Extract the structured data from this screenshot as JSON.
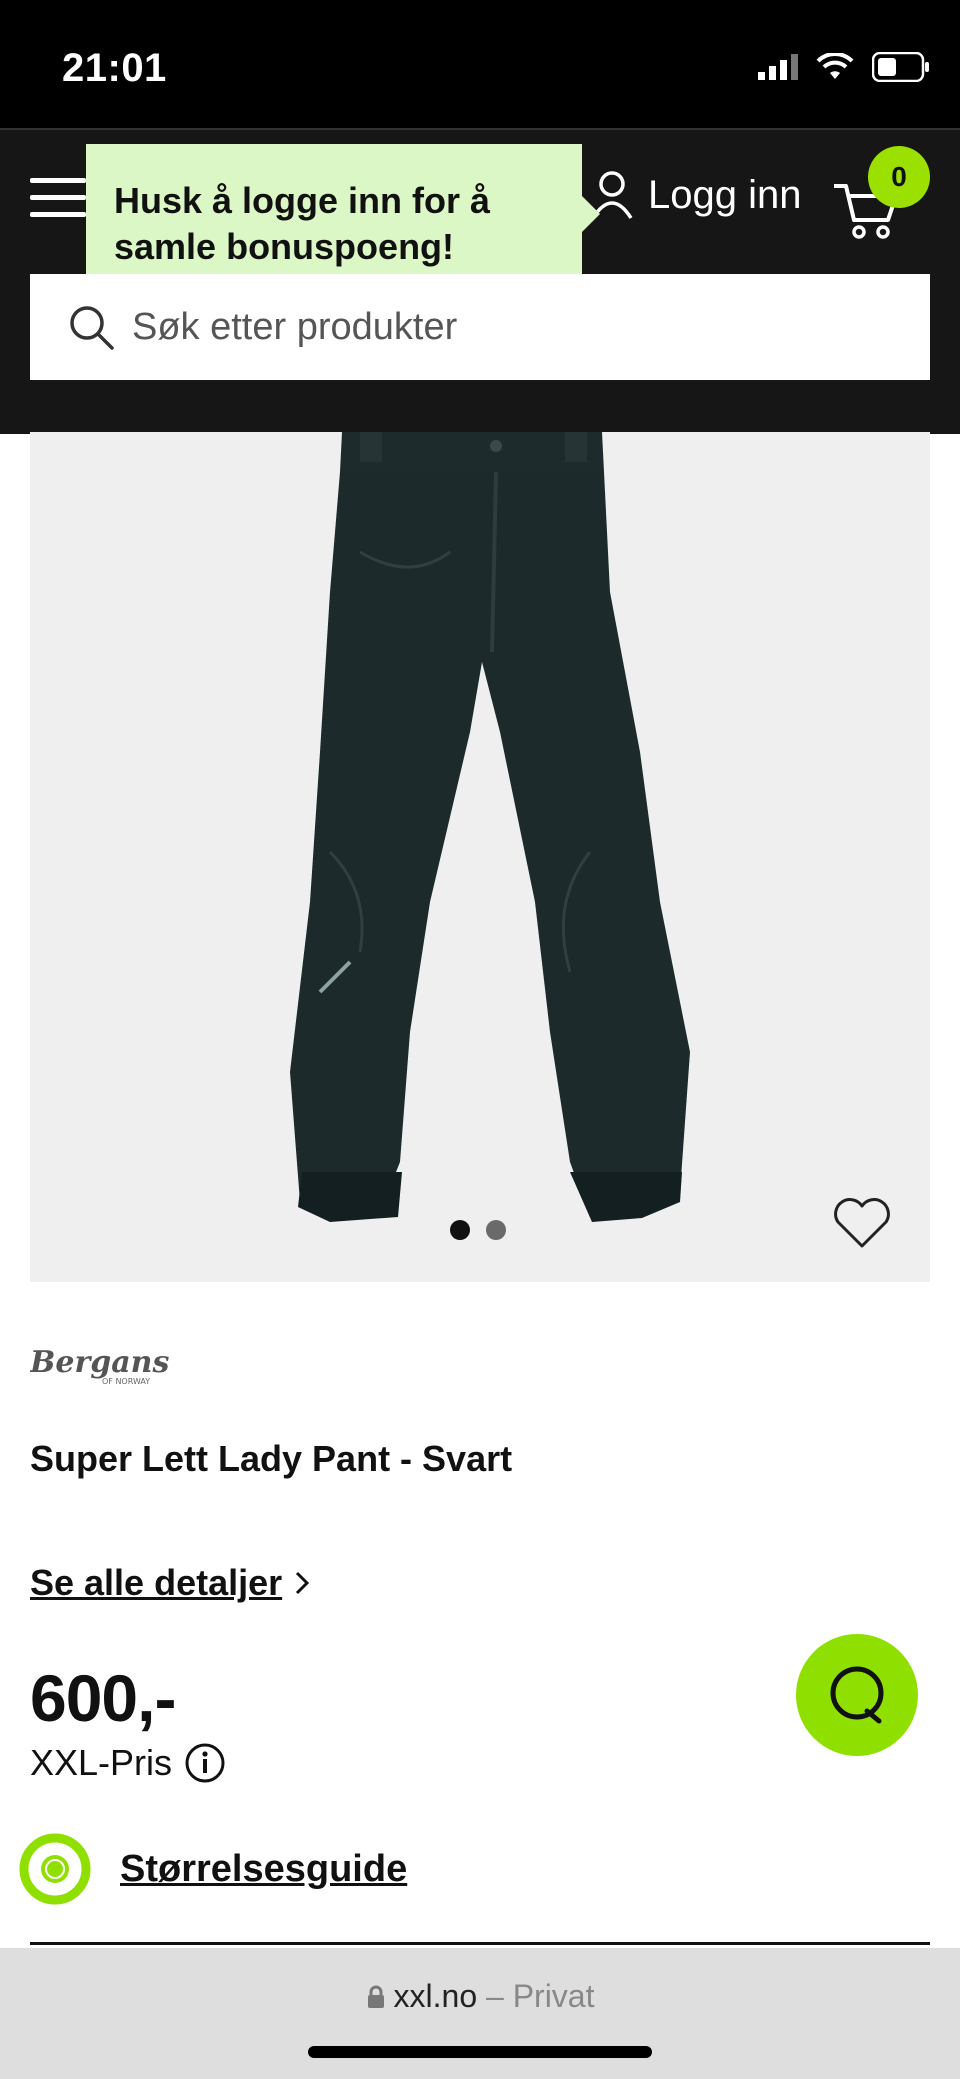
{
  "status": {
    "time": "21:01"
  },
  "header": {
    "tooltip": "Husk å logge inn for å samle bonuspoeng!",
    "login_label": "Logg inn",
    "cart_count": "0",
    "search_placeholder": "Søk etter produkter",
    "accent_color": "#9be000"
  },
  "gallery": {
    "dots": 2,
    "active_index": 0
  },
  "product": {
    "brand": "Bergans",
    "brand_sub": "OF NORWAY",
    "title": "Super Lett Lady Pant - Svart",
    "details_link": "Se alle detaljer",
    "price": "600,-",
    "price_label": "XXL-Pris",
    "size_guide": "Størrelsesguide"
  },
  "browser": {
    "domain": "xxl.no",
    "suffix": "– Privat"
  }
}
